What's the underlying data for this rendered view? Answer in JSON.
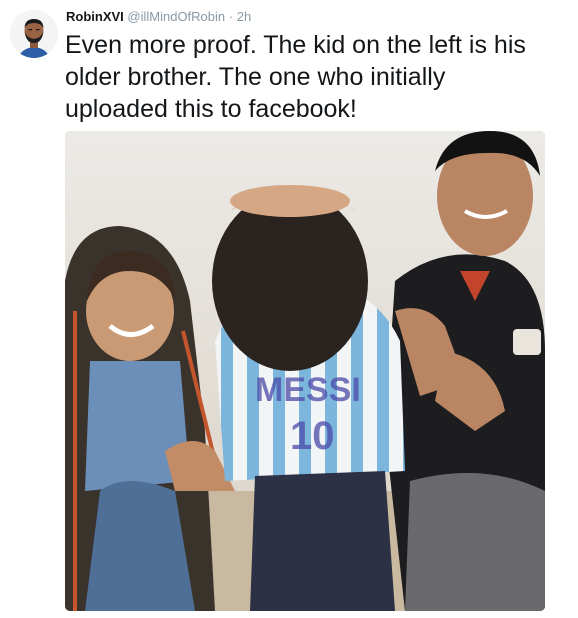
{
  "tweet": {
    "author": {
      "name": "RobinXVI",
      "handle": "@illMindOfRobin",
      "separator": "·",
      "time": "2h",
      "avatar_icon": "drake-avatar-icon"
    },
    "text": "Even more proof. The kid on the left is his\nolder brother. The one who initially\nuploaded this to facebook!",
    "media": {
      "type": "photo",
      "shirt_text": "MESSI 10"
    }
  },
  "colors": {
    "text": "#14171a",
    "muted": "#8899a6",
    "shirt_blue": "#7db6dc",
    "shirt_white": "#f2f4f6"
  }
}
